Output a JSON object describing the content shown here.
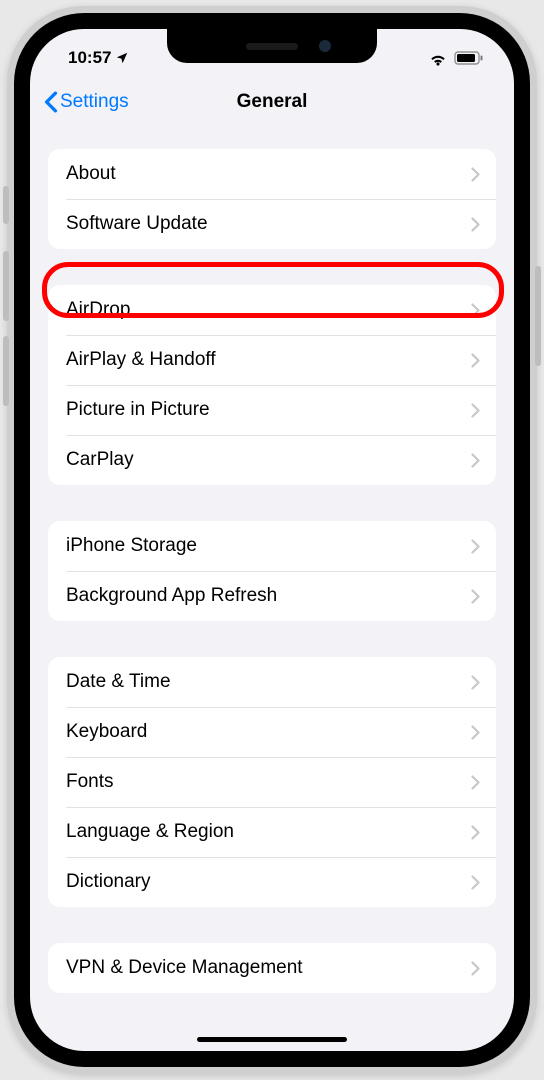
{
  "status": {
    "time": "10:57",
    "location_icon": "location-arrow-icon",
    "wifi_icon": "wifi-icon",
    "battery_icon": "battery-icon"
  },
  "nav": {
    "back_label": "Settings",
    "title": "General"
  },
  "groups": [
    {
      "rows": [
        {
          "label": "About",
          "name": "row-about"
        },
        {
          "label": "Software Update",
          "name": "row-software-update",
          "highlighted": true
        }
      ]
    },
    {
      "rows": [
        {
          "label": "AirDrop",
          "name": "row-airdrop"
        },
        {
          "label": "AirPlay & Handoff",
          "name": "row-airplay-handoff"
        },
        {
          "label": "Picture in Picture",
          "name": "row-picture-in-picture"
        },
        {
          "label": "CarPlay",
          "name": "row-carplay"
        }
      ]
    },
    {
      "rows": [
        {
          "label": "iPhone Storage",
          "name": "row-iphone-storage"
        },
        {
          "label": "Background App Refresh",
          "name": "row-background-app-refresh"
        }
      ]
    },
    {
      "rows": [
        {
          "label": "Date & Time",
          "name": "row-date-time"
        },
        {
          "label": "Keyboard",
          "name": "row-keyboard"
        },
        {
          "label": "Fonts",
          "name": "row-fonts"
        },
        {
          "label": "Language & Region",
          "name": "row-language-region"
        },
        {
          "label": "Dictionary",
          "name": "row-dictionary"
        }
      ]
    },
    {
      "rows": [
        {
          "label": "VPN & Device Management",
          "name": "row-vpn-device-management"
        }
      ]
    }
  ],
  "annotation": {
    "highlight_target": "row-software-update"
  }
}
